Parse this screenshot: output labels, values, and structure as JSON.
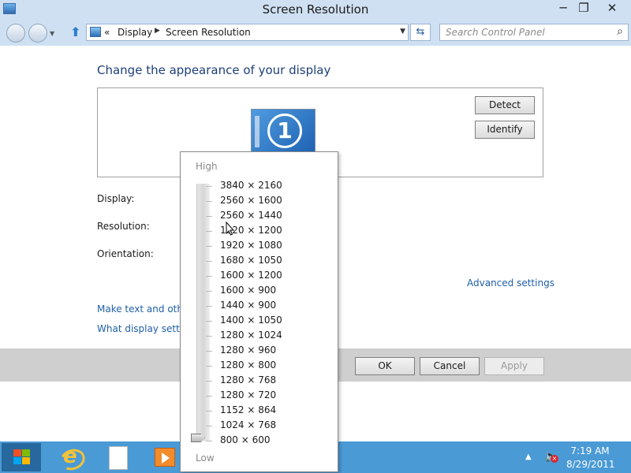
{
  "window": {
    "title": "Screen Resolution",
    "minimize": "─",
    "maximize": "❐",
    "close": "✕"
  },
  "address": {
    "crumbs": [
      "«",
      "Display",
      "Screen Resolution"
    ],
    "search_placeholder": "Search Control Panel"
  },
  "main": {
    "heading": "Change the appearance of your display",
    "monitor_number": "1",
    "detect_label": "Detect",
    "identify_label": "Identify",
    "display_label": "Display:",
    "resolution_label": "Resolution:",
    "orientation_label": "Orientation:",
    "advanced_link": "Advanced settings",
    "link_text_size": "Make text and other",
    "link_display_settings": "What display setting"
  },
  "footer": {
    "ok": "OK",
    "cancel": "Cancel",
    "apply": "Apply"
  },
  "resolution_popup": {
    "high_label": "High",
    "low_label": "Low",
    "selected": "800 × 600",
    "options": [
      "3840 × 2160",
      "2560 × 1600",
      "2560 × 1440",
      "1920 × 1200",
      "1920 × 1080",
      "1680 × 1050",
      "1600 × 1200",
      "1600 × 900",
      "1440 × 900",
      "1400 × 1050",
      "1280 × 1024",
      "1280 × 960",
      "1280 × 800",
      "1280 × 768",
      "1280 × 720",
      "1152 × 864",
      "1024 × 768",
      "800 × 600"
    ]
  },
  "taskbar": {
    "time": "7:19 AM",
    "date": "8/29/2011"
  },
  "colors": {
    "chrome": "#cfe0f2",
    "link": "#1f5fa8",
    "heading": "#1e3f7a",
    "taskbar": "#4a9ad6"
  }
}
